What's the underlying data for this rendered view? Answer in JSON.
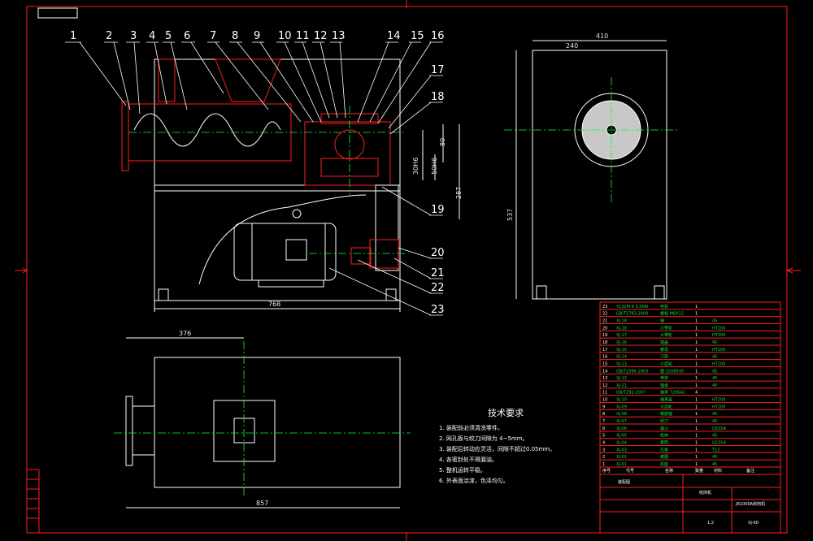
{
  "part_numbers": [
    "1",
    "2",
    "3",
    "4",
    "5",
    "6",
    "7",
    "8",
    "9",
    "10",
    "11",
    "12",
    "13",
    "14",
    "15",
    "16",
    "17",
    "18",
    "19",
    "20",
    "21",
    "22",
    "23"
  ],
  "dimensions": {
    "front_width": "768",
    "side_width": "410",
    "side_inner": "240",
    "side_height": "537",
    "top_width": "857",
    "top_offset": "376",
    "front_v1": "287",
    "front_v2": "80",
    "front_v3": "30H6",
    "front_v4": "50H6"
  },
  "tech": {
    "title": "技术要求",
    "lines": [
      "1. 装配前必须清洗零件。",
      "2. 网孔板与绞刀间隙为 4~5mm。",
      "3. 装配后转动应灵活，间隙不超过0.05mm。",
      "4. 各密封处不得漏油。",
      "5. 整机运转平稳。",
      "6. 外表面涂漆，色泽均匀。"
    ]
  },
  "bom": {
    "rows": [
      [
        "23",
        "Y132M-4 5.5KW",
        "电机",
        "1",
        ""
      ],
      [
        "22",
        "GB/T5783-2000",
        "螺栓 M8X12",
        "1",
        ""
      ],
      [
        "21",
        "XJ-18",
        "轴",
        "1",
        "45"
      ],
      [
        "20",
        "XJ-18",
        "小带轮",
        "1",
        "HT200"
      ],
      [
        "19",
        "XJ-17",
        "大带轮",
        "1",
        "HT200"
      ],
      [
        "18",
        "XJ-16",
        "端盖",
        "1",
        "45"
      ],
      [
        "17",
        "XJ-15",
        "螺母",
        "1",
        "HT200"
      ],
      [
        "16",
        "XJ-14",
        "刀架",
        "1",
        "45"
      ],
      [
        "15",
        "XJ-13",
        "小齿轮",
        "1",
        "HT200"
      ],
      [
        "14",
        "GB/T1096-2003",
        "键 10X8X45",
        "1",
        "45"
      ],
      [
        "13",
        "XJ-12",
        "壳体",
        "1",
        "45"
      ],
      [
        "12",
        "XJ-11",
        "轴承",
        "1",
        "45"
      ],
      [
        "11",
        "GB/T292-2007",
        "轴承 7206AC",
        "4",
        ""
      ],
      [
        "10",
        "XJ-10",
        "轴承盖",
        "1",
        "HT200"
      ],
      [
        "9",
        "XJ-09",
        "大齿轮",
        "1",
        "HT200"
      ],
      [
        "8",
        "XJ-08",
        "螺旋轴",
        "1",
        "45"
      ],
      [
        "7",
        "XJ-07",
        "绞刀",
        "1",
        "45"
      ],
      [
        "6",
        "XJ-06",
        "漏斗",
        "1",
        "Q235A"
      ],
      [
        "5",
        "XJ-05",
        "机体",
        "1",
        "45"
      ],
      [
        "4",
        "XJ-04",
        "套筒",
        "1",
        "Q235A"
      ],
      [
        "3",
        "XJ-03",
        "孔板",
        "1",
        "T12"
      ],
      [
        "2",
        "XJ-02",
        "螺圈",
        "1",
        "45"
      ],
      [
        "1",
        "XJ-01",
        "机座",
        "1",
        "45"
      ]
    ],
    "header": [
      "序号",
      "代号",
      "名称",
      "数量",
      "材料",
      "备注"
    ],
    "title_block": {
      "name": "绞肉机",
      "drawing_title": "JR1000A绞肉机",
      "code": "XJ-00",
      "scale": "1:2",
      "company": "装配图"
    }
  }
}
